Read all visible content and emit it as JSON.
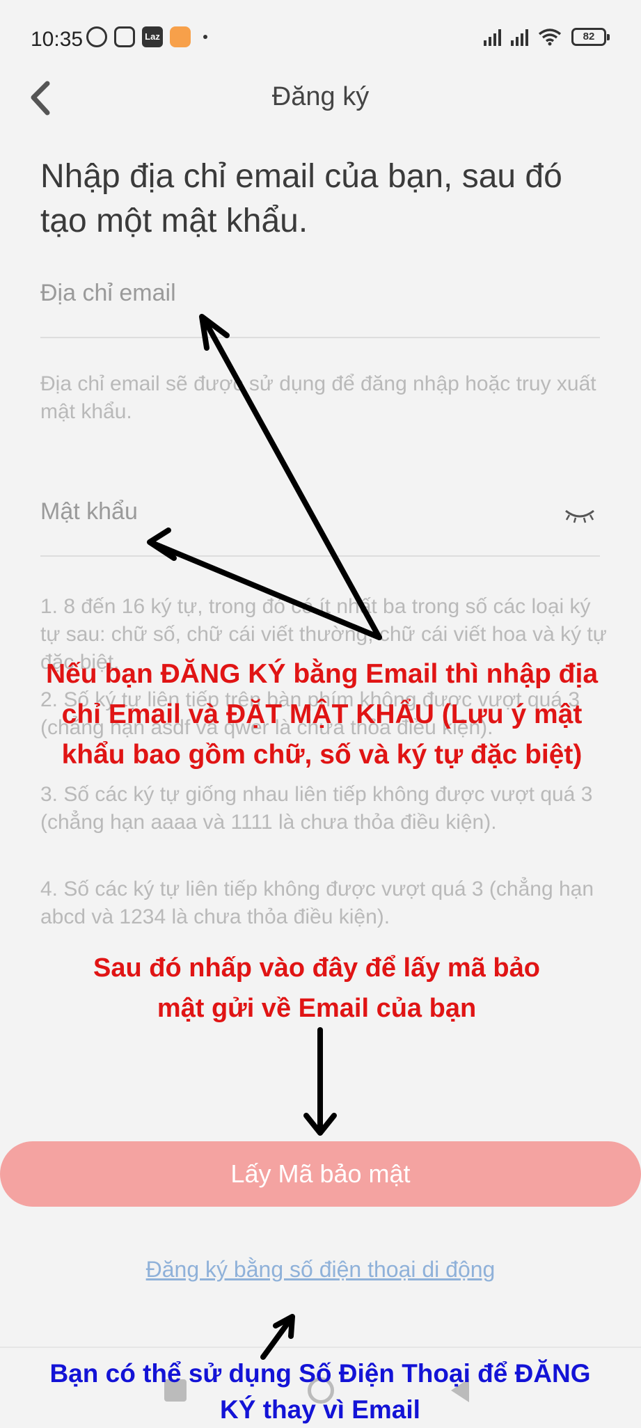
{
  "status_bar": {
    "time": "10:35",
    "laz_icon_text": "Laz",
    "battery": "82"
  },
  "header": {
    "title": "Đăng ký"
  },
  "heading": "Nhập địa chỉ email của bạn, sau đó tạo một mật khẩu.",
  "email": {
    "placeholder": "Địa chỉ email",
    "value": "",
    "hint": "Địa chỉ email sẽ được sử dụng để đăng nhập hoặc truy xuất mật khẩu."
  },
  "password": {
    "placeholder": "Mật khẩu",
    "value": "",
    "rules": [
      "1. 8 đến 16 ký tự, trong đó có ít nhất ba trong số các loại ký tự sau: chữ số, chữ cái viết thường, chữ cái viết hoa và ký tự đặc biệt.",
      "2. Số ký tự liên tiếp trên bàn phím không được vượt quá 3 (chẳng hạn asdf và qwer là chưa thỏa điều kiện).",
      "3. Số các ký tự giống nhau liên tiếp không được vượt quá 3 (chẳng hạn aaaa và 1111 là chưa thỏa điều kiện).",
      "4. Số các ký tự liên tiếp không được vượt quá 3 (chẳng hạn abcd và 1234 là chưa thỏa điều kiện)."
    ]
  },
  "get_code_button": "Lấy Mã bảo mật",
  "phone_signup_link": "Đăng ký bằng số điện thoại di động",
  "annotations": {
    "signup_instruction": "Nếu bạn ĐĂNG KÝ bằng Email thì nhập địa chỉ Email và ĐẶT MẬT KHẨU (Lưu ý mật khẩu bao gồm chữ, số và ký tự đặc biệt)",
    "click_here": "Sau đó nhấp vào đây để lấy mã bảo mật gửi về Email của bạn",
    "phone_tip": "Bạn có thể sử dụng Số Điện Thoại để ĐĂNG KÝ thay vì Email"
  },
  "colors": {
    "annotation_red": "#e01414",
    "annotation_blue": "#1313d6",
    "button_bg": "#f4a3a1",
    "link": "#8fb1d9"
  },
  "icons": [
    "back-chevron-icon",
    "eye-closed-icon",
    "alarm-icon",
    "face-icon",
    "laz-icon",
    "mi-icon",
    "signal-icon",
    "wifi-icon",
    "battery-icon"
  ]
}
